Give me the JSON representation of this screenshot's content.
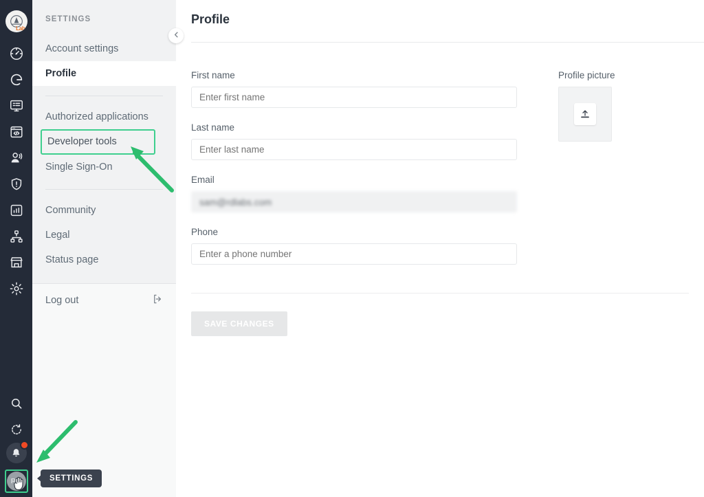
{
  "rail": {
    "logo": {
      "name": "app-logo",
      "text": "Lab"
    },
    "icons": [
      {
        "name": "dashboard-gauge-icon"
      },
      {
        "name": "grafana-g-icon"
      },
      {
        "name": "monitor-list-icon"
      },
      {
        "name": "code-browser-icon"
      },
      {
        "name": "users-icon"
      },
      {
        "name": "shield-alert-icon"
      },
      {
        "name": "chart-report-icon"
      },
      {
        "name": "sitemap-icon"
      },
      {
        "name": "marketplace-store-icon"
      },
      {
        "name": "gear-settings-icon"
      }
    ],
    "bottom": {
      "search": "search-icon",
      "history": "history-refresh-icon",
      "notifications": "bell-icon",
      "avatar_initials": "RO"
    }
  },
  "sidebar": {
    "title": "SETTINGS",
    "groups": [
      {
        "items": [
          {
            "label": "Account settings",
            "active": false
          },
          {
            "label": "Profile",
            "active": true
          }
        ]
      },
      {
        "items": [
          {
            "label": "Authorized applications",
            "active": false,
            "highlighted": false
          },
          {
            "label": "Developer tools",
            "active": false,
            "highlighted": true
          },
          {
            "label": "Single Sign-On",
            "active": false,
            "highlighted": false
          }
        ]
      },
      {
        "items": [
          {
            "label": "Community",
            "active": false
          },
          {
            "label": "Legal",
            "active": false
          },
          {
            "label": "Status page",
            "active": false
          }
        ]
      }
    ],
    "logout": {
      "label": "Log out",
      "icon": "logout-icon"
    },
    "collapse": {
      "icon": "chevron-left-icon"
    }
  },
  "main": {
    "title": "Profile",
    "fields": [
      {
        "id": "first_name",
        "label": "First name",
        "value": "",
        "placeholder": "Enter first name",
        "readonly": false
      },
      {
        "id": "last_name",
        "label": "Last name",
        "value": "",
        "placeholder": "Enter last name",
        "readonly": false
      },
      {
        "id": "email",
        "label": "Email",
        "value": "sam@rdlabs.com",
        "placeholder": "",
        "readonly": true
      },
      {
        "id": "phone",
        "label": "Phone",
        "value": "",
        "placeholder": "Enter a phone number",
        "readonly": false
      }
    ],
    "profile_picture": {
      "label": "Profile picture",
      "icon": "upload-icon"
    },
    "save_button": {
      "label": "SAVE CHANGES",
      "disabled": true
    }
  },
  "annotations": {
    "tooltip_text": "SETTINGS",
    "highlight_color": "#3ecf8e",
    "arrow_color": "#2dbd6e",
    "badge_color": "#ef4a25"
  }
}
